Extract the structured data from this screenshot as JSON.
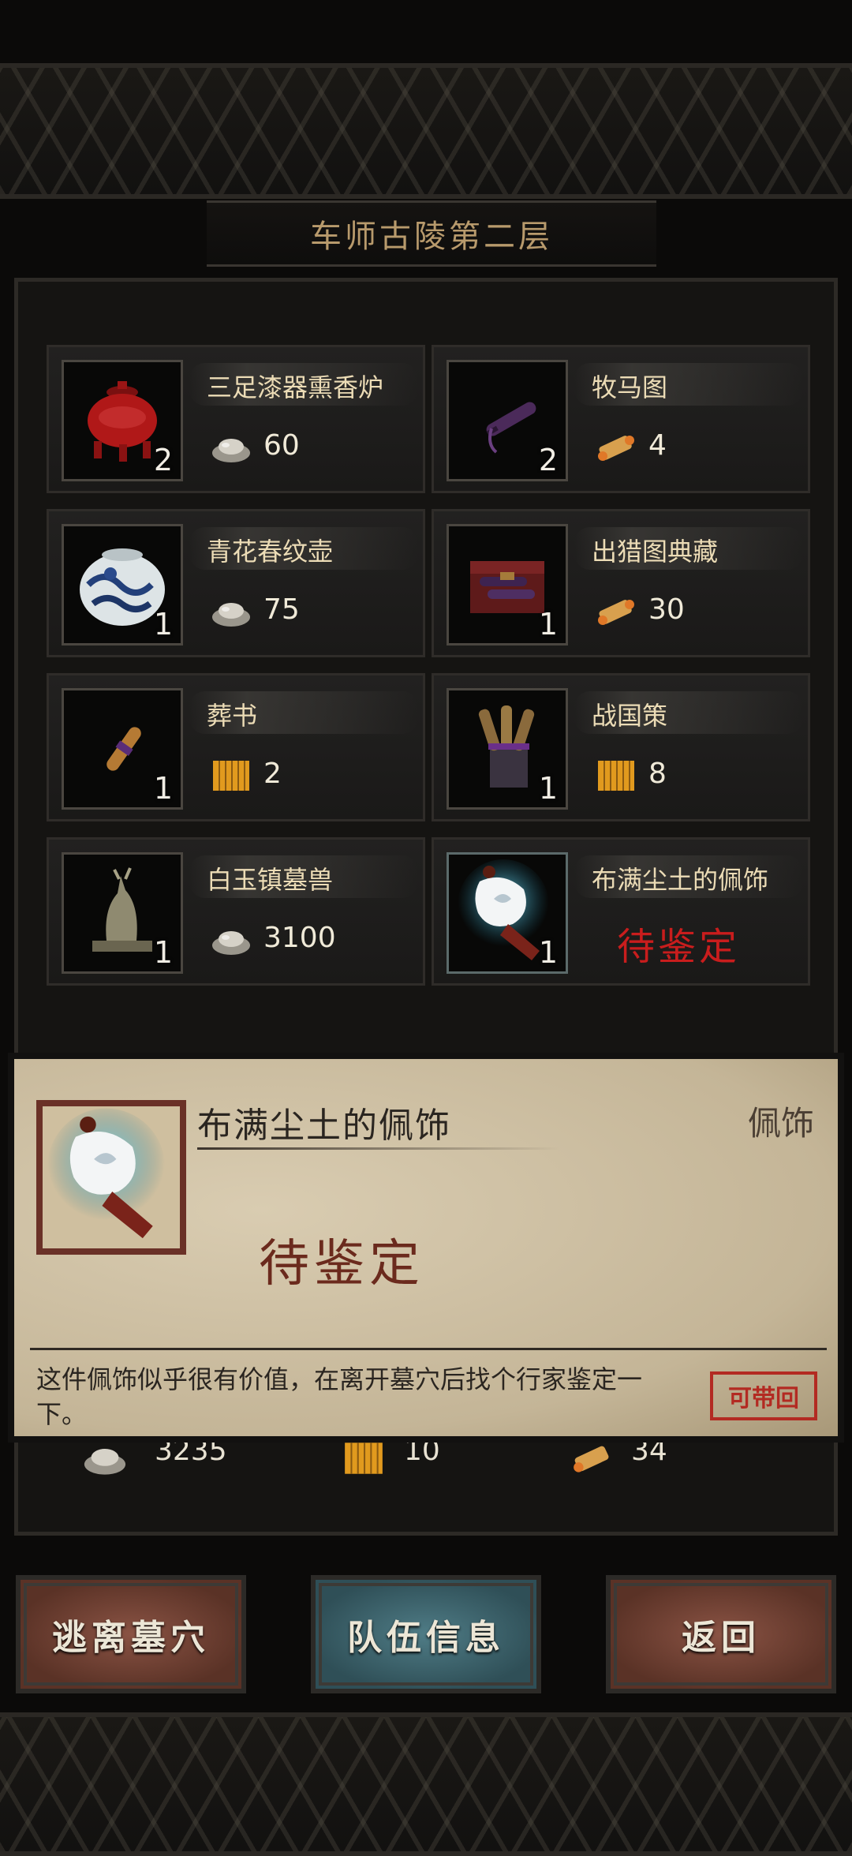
{
  "header": {
    "title": "车师古陵第二层"
  },
  "items": [
    {
      "name": "三足漆器熏香炉",
      "qty": "2",
      "currency": "silver-icon",
      "price": "60",
      "icon": "red-lacquer-censer-icon"
    },
    {
      "name": "牧马图",
      "qty": "2",
      "currency": "scroll-icon",
      "price": "4",
      "icon": "horse-painting-scroll-icon"
    },
    {
      "name": "青花春纹壶",
      "qty": "1",
      "currency": "silver-icon",
      "price": "75",
      "icon": "blue-white-jar-icon"
    },
    {
      "name": "出猎图典藏",
      "qty": "1",
      "currency": "scroll-icon",
      "price": "30",
      "icon": "hunting-painting-chest-icon"
    },
    {
      "name": "葬书",
      "qty": "1",
      "currency": "bamboo-slip-icon",
      "price": "2",
      "icon": "burial-book-scroll-icon"
    },
    {
      "name": "战国策",
      "qty": "1",
      "currency": "bamboo-slip-icon",
      "price": "8",
      "icon": "scroll-bundle-icon"
    },
    {
      "name": "白玉镇墓兽",
      "qty": "1",
      "currency": "silver-icon",
      "price": "3100",
      "icon": "jade-tomb-beast-icon"
    },
    {
      "name": "布满尘土的佩饰",
      "qty": "1",
      "status": "待鉴定",
      "icon": "dusty-pendant-icon"
    }
  ],
  "totals": {
    "silver": "3235",
    "bamboo": "10",
    "scroll": "34"
  },
  "popup": {
    "name": "布满尘土的佩饰",
    "type": "佩饰",
    "status": "待鉴定",
    "description": "这件佩饰似乎很有价值，在离开墓穴后找个行家鉴定一下。",
    "stamp": "可带回"
  },
  "buttons": {
    "escape": "逃离墓穴",
    "team": "队伍信息",
    "back": "返回"
  },
  "colors": {
    "pending": "#c91d1d",
    "title": "#b89a6c",
    "stamp": "#b32a22"
  }
}
